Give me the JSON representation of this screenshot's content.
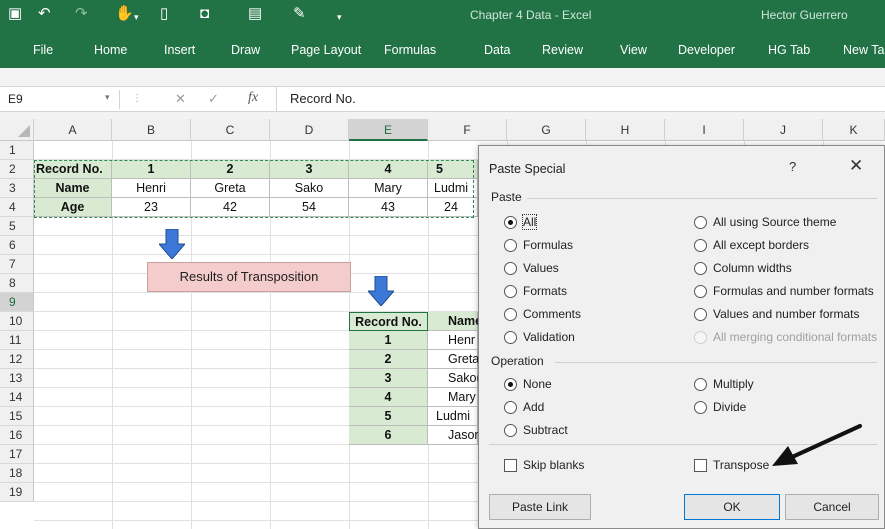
{
  "titlebar": {
    "window_title": "Chapter 4 Data  -  Excel",
    "user": "Hector Guerrero",
    "quick_access": [
      "save-icon",
      "undo-icon",
      "redo-icon",
      "touch-mode-icon",
      "form-icon",
      "camera-icon",
      "spreadsheet-icon",
      "brush-icon",
      "customize-icon"
    ]
  },
  "ribbon": {
    "tabs": [
      "File",
      "Home",
      "Insert",
      "Draw",
      "Page Layout",
      "Formulas",
      "Data",
      "Review",
      "View",
      "Developer",
      "HG Tab",
      "New Ta"
    ]
  },
  "formula_bar": {
    "name_box": "E9",
    "fx": "fx",
    "content": "Record No."
  },
  "columns": [
    "A",
    "B",
    "C",
    "D",
    "E",
    "F",
    "G",
    "H",
    "I",
    "J",
    "K"
  ],
  "rows": [
    "1",
    "2",
    "3",
    "4",
    "5",
    "6",
    "7",
    "8",
    "9",
    "10",
    "11",
    "12",
    "13",
    "14",
    "15",
    "16",
    "17",
    "18",
    "19"
  ],
  "source_table": {
    "row1": [
      "Record No.",
      "1",
      "2",
      "3",
      "4",
      "5"
    ],
    "row2": [
      "Name",
      "Henri",
      "Greta",
      "Sako",
      "Mary",
      "Ludmi"
    ],
    "row3": [
      "Age",
      "23",
      "42",
      "54",
      "43",
      "24"
    ]
  },
  "callout": "Results of Transposition",
  "transposed_table": {
    "header": [
      "Record No.",
      "Name"
    ],
    "rows": [
      [
        "1",
        "Henr"
      ],
      [
        "2",
        "Greta"
      ],
      [
        "3",
        "Sako("
      ],
      [
        "4",
        "Mary"
      ],
      [
        "5",
        "Ludmi"
      ],
      [
        "6",
        "Jasor"
      ]
    ]
  },
  "dialog": {
    "title": "Paste Special",
    "help": "?",
    "close": "✕",
    "paste_section": "Paste",
    "paste_left": [
      "All",
      "Formulas",
      "Values",
      "Formats",
      "Comments",
      "Validation"
    ],
    "paste_right": [
      "All using Source theme",
      "All except borders",
      "Column widths",
      "Formulas and number formats",
      "Values and number formats",
      "All merging conditional formats"
    ],
    "paste_selected": "All",
    "operation_section": "Operation",
    "operation_left": [
      "None",
      "Add",
      "Subtract"
    ],
    "operation_right": [
      "Multiply",
      "Divide"
    ],
    "operation_selected": "None",
    "skip_blanks": "Skip blanks",
    "transpose": "Transpose",
    "paste_link": "Paste Link",
    "ok": "OK",
    "cancel": "Cancel"
  },
  "colors": {
    "excel_green": "#217346",
    "cell_green": "#d9ead3",
    "pink": "#f4cccc",
    "blue_arrow": "#3c78d8"
  }
}
